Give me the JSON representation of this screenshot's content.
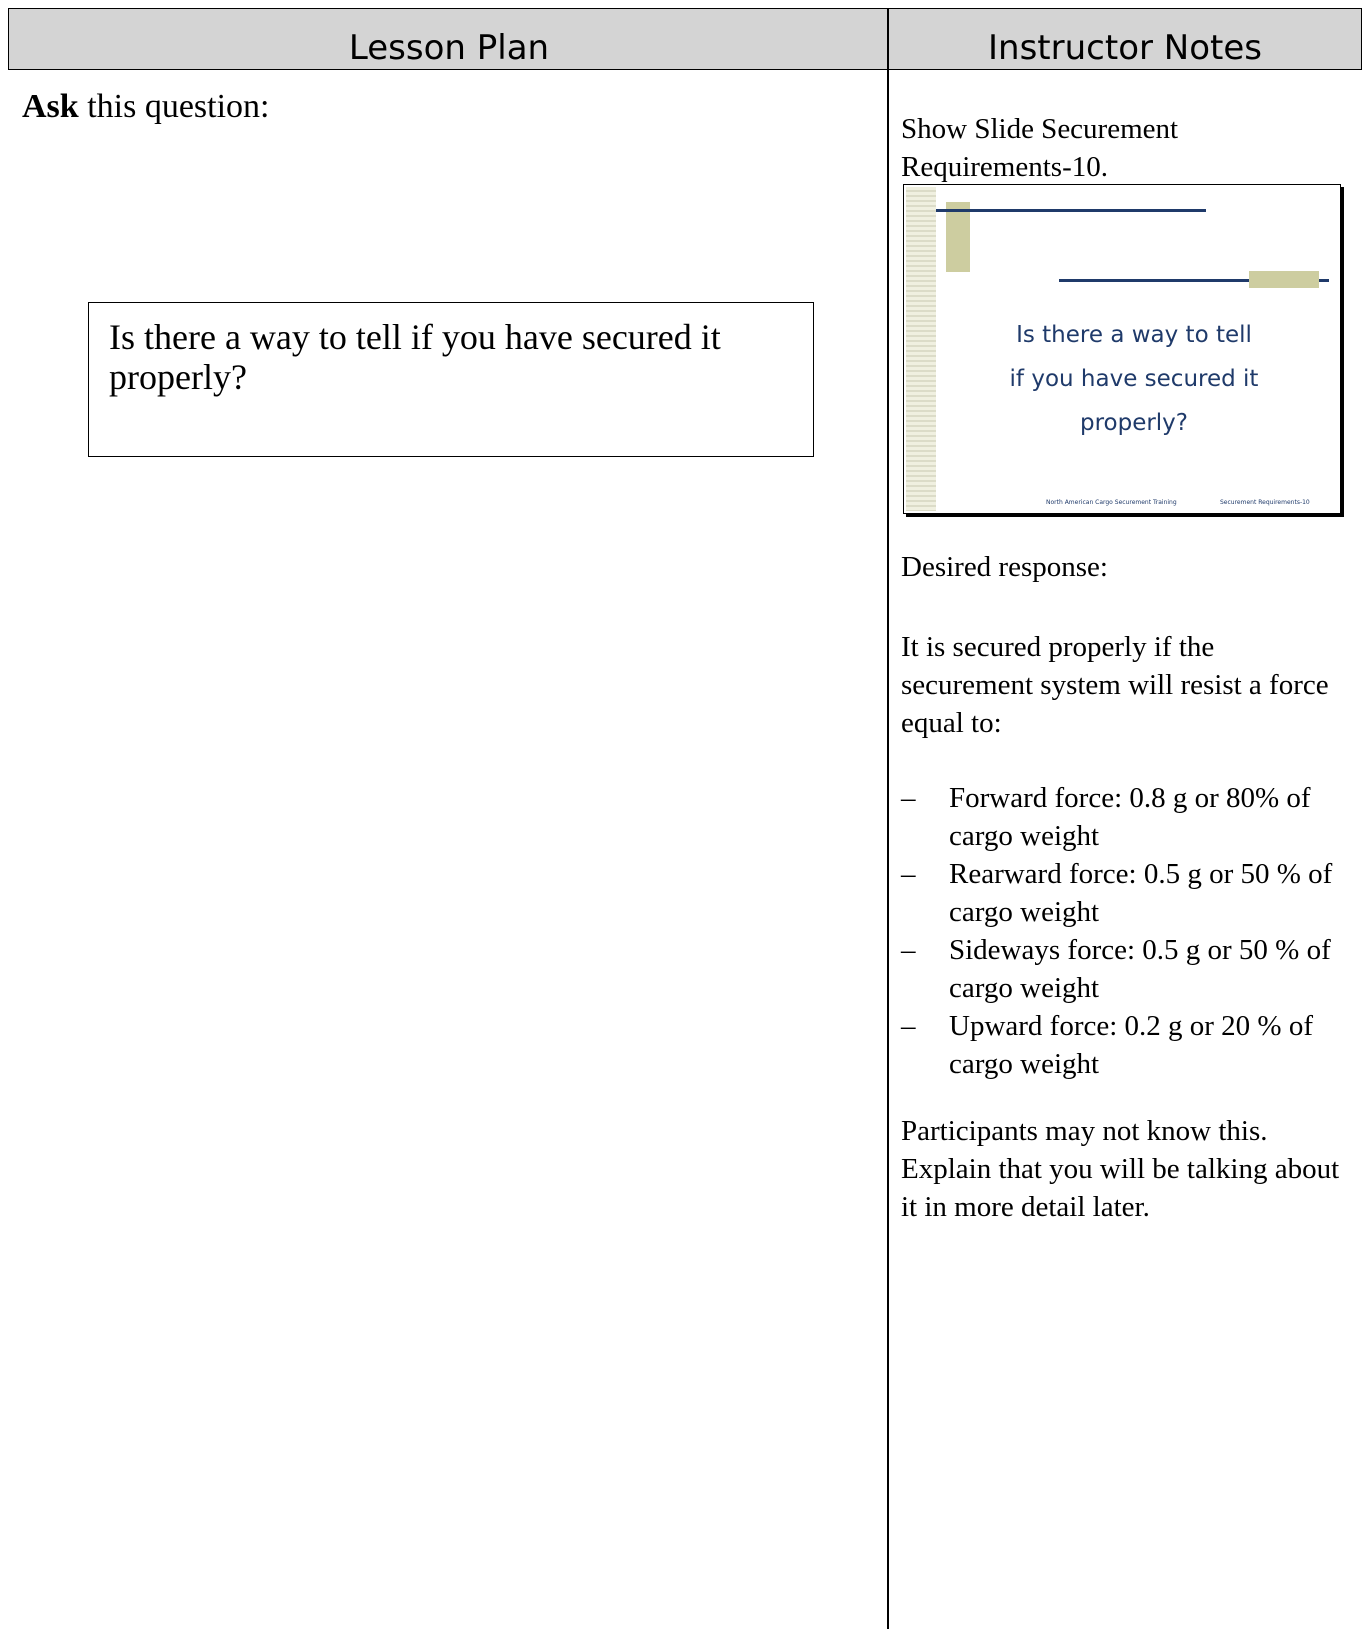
{
  "header": {
    "left_title": "Lesson Plan",
    "right_title": "Instructor Notes"
  },
  "lesson": {
    "ask_bold": "Ask",
    "ask_rest": " this question:",
    "question": "Is there a way to tell if you have secured it properly?"
  },
  "notes": {
    "show_slide": "Show Slide Securement Requirements-10.",
    "slide": {
      "line1": "Is there a way to tell",
      "line2": "if you have secured it",
      "line3": "properly?",
      "footer_left": "North American Cargo Securement Training",
      "footer_right": "Securement Requirements-10",
      "accent_color": "#1f3a6a",
      "block_color": "#cdcda0"
    },
    "desired_label": "Desired response:",
    "answer_intro": "It is secured properly if the securement system will resist a force equal to:",
    "forces": [
      {
        "dash": "–",
        "text": "Forward force: 0.8 g or 80% of cargo weight"
      },
      {
        "dash": "–",
        "text": "Rearward force: 0.5 g or 50 % of cargo weight"
      },
      {
        "dash": "–",
        "text": "Sideways force: 0.5 g or 50 % of cargo weight"
      },
      {
        "dash": "–",
        "text": "Upward force: 0.2 g or 20 % of cargo weight"
      }
    ],
    "closing": "Participants may not know this. Explain that you will be talking about it in more detail later."
  }
}
